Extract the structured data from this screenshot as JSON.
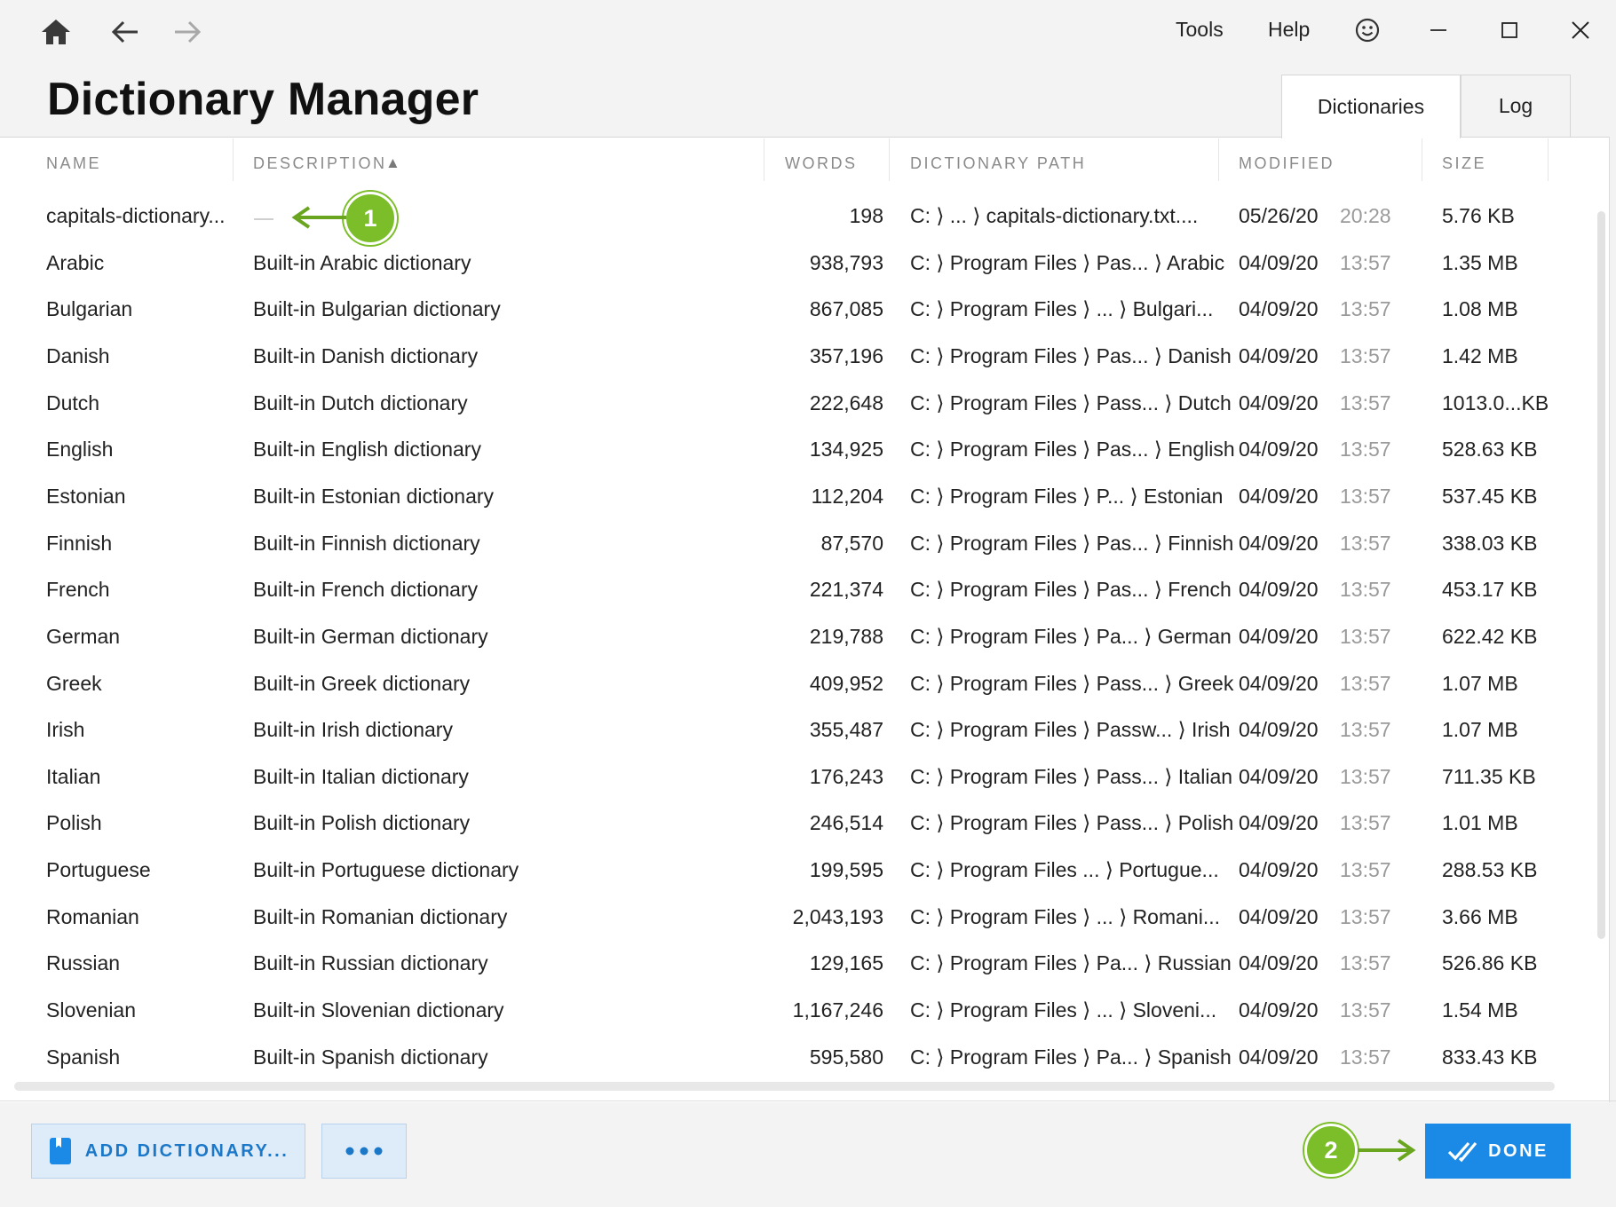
{
  "toolbar": {
    "home": "home-icon",
    "back": "back-arrow-icon",
    "forward": "forward-arrow-icon",
    "menu": [
      "Tools",
      "Help"
    ],
    "feedback": "smiley-icon",
    "minimize": "minimize-icon",
    "maximize": "maximize-icon",
    "close": "close-icon"
  },
  "page": {
    "title": "Dictionary Manager"
  },
  "tabs": [
    {
      "label": "Dictionaries",
      "active": true
    },
    {
      "label": "Log",
      "active": false
    }
  ],
  "table": {
    "columns": [
      "NAME",
      "DESCRIPTION",
      "WORDS",
      "DICTIONARY PATH",
      "MODIFIED",
      "SIZE"
    ],
    "sort": {
      "column": "DESCRIPTION",
      "direction": "ascending",
      "indicator": "▲"
    },
    "rows": [
      {
        "name": "capitals-dictionary...",
        "description": "",
        "words": "198",
        "path": "C: ⟩ ... ⟩ capitals-dictionary.txt....",
        "date": "05/26/20",
        "time": "20:28",
        "size": "5.76 KB"
      },
      {
        "name": "Arabic",
        "description": "Built-in Arabic dictionary",
        "words": "938,793",
        "path": "C: ⟩ Program Files ⟩ Pas... ⟩ Arabic",
        "date": "04/09/20",
        "time": "13:57",
        "size": "1.35 MB"
      },
      {
        "name": "Bulgarian",
        "description": "Built-in Bulgarian dictionary",
        "words": "867,085",
        "path": "C: ⟩ Program Files ⟩ ... ⟩ Bulgari...",
        "date": "04/09/20",
        "time": "13:57",
        "size": "1.08 MB"
      },
      {
        "name": "Danish",
        "description": "Built-in Danish dictionary",
        "words": "357,196",
        "path": "C: ⟩ Program Files ⟩ Pas... ⟩ Danish",
        "date": "04/09/20",
        "time": "13:57",
        "size": "1.42 MB"
      },
      {
        "name": "Dutch",
        "description": "Built-in Dutch dictionary",
        "words": "222,648",
        "path": "C: ⟩ Program Files ⟩ Pass... ⟩ Dutch",
        "date": "04/09/20",
        "time": "13:57",
        "size": "1013.0...KB"
      },
      {
        "name": "English",
        "description": "Built-in English dictionary",
        "words": "134,925",
        "path": "C: ⟩ Program Files ⟩ Pas... ⟩ English",
        "date": "04/09/20",
        "time": "13:57",
        "size": "528.63 KB"
      },
      {
        "name": "Estonian",
        "description": "Built-in Estonian dictionary",
        "words": "112,204",
        "path": "C: ⟩ Program Files ⟩ P... ⟩ Estonian",
        "date": "04/09/20",
        "time": "13:57",
        "size": "537.45 KB"
      },
      {
        "name": "Finnish",
        "description": "Built-in Finnish dictionary",
        "words": "87,570",
        "path": "C: ⟩ Program Files ⟩ Pas... ⟩ Finnish",
        "date": "04/09/20",
        "time": "13:57",
        "size": "338.03 KB"
      },
      {
        "name": "French",
        "description": "Built-in French dictionary",
        "words": "221,374",
        "path": "C: ⟩ Program Files ⟩ Pas... ⟩ French",
        "date": "04/09/20",
        "time": "13:57",
        "size": "453.17 KB"
      },
      {
        "name": "German",
        "description": "Built-in German dictionary",
        "words": "219,788",
        "path": "C: ⟩ Program Files ⟩ Pa... ⟩ German",
        "date": "04/09/20",
        "time": "13:57",
        "size": "622.42 KB"
      },
      {
        "name": "Greek",
        "description": "Built-in Greek dictionary",
        "words": "409,952",
        "path": "C: ⟩ Program Files ⟩ Pass... ⟩ Greek",
        "date": "04/09/20",
        "time": "13:57",
        "size": "1.07 MB"
      },
      {
        "name": "Irish",
        "description": "Built-in Irish dictionary",
        "words": "355,487",
        "path": "C: ⟩ Program Files ⟩ Passw... ⟩ Irish",
        "date": "04/09/20",
        "time": "13:57",
        "size": "1.07 MB"
      },
      {
        "name": "Italian",
        "description": "Built-in Italian dictionary",
        "words": "176,243",
        "path": "C: ⟩ Program Files ⟩ Pass... ⟩ Italian",
        "date": "04/09/20",
        "time": "13:57",
        "size": "711.35 KB"
      },
      {
        "name": "Polish",
        "description": "Built-in Polish dictionary",
        "words": "246,514",
        "path": "C: ⟩ Program Files ⟩ Pass... ⟩ Polish",
        "date": "04/09/20",
        "time": "13:57",
        "size": "1.01 MB"
      },
      {
        "name": "Portuguese",
        "description": "Built-in Portuguese dictionary",
        "words": "199,595",
        "path": "C: ⟩ Program Files ... ⟩ Portugue...",
        "date": "04/09/20",
        "time": "13:57",
        "size": "288.53 KB"
      },
      {
        "name": "Romanian",
        "description": "Built-in Romanian dictionary",
        "words": "2,043,193",
        "path": "C: ⟩ Program Files ⟩ ... ⟩ Romani...",
        "date": "04/09/20",
        "time": "13:57",
        "size": "3.66 MB"
      },
      {
        "name": "Russian",
        "description": "Built-in Russian dictionary",
        "words": "129,165",
        "path": "C: ⟩ Program Files ⟩ Pa... ⟩ Russian",
        "date": "04/09/20",
        "time": "13:57",
        "size": "526.86 KB"
      },
      {
        "name": "Slovenian",
        "description": "Built-in Slovenian dictionary",
        "words": "1,167,246",
        "path": "C: ⟩ Program Files ⟩ ... ⟩ Sloveni...",
        "date": "04/09/20",
        "time": "13:57",
        "size": "1.54 MB"
      },
      {
        "name": "Spanish",
        "description": "Built-in Spanish dictionary",
        "words": "595,580",
        "path": "C: ⟩ Program Files ⟩ Pa... ⟩ Spanish",
        "date": "04/09/20",
        "time": "13:57",
        "size": "833.43 KB"
      }
    ]
  },
  "footer": {
    "add_label": "ADD DICTIONARY...",
    "add_icon": "dictionary-book-icon",
    "more_icon": "more-dots-icon",
    "done_label": "DONE",
    "done_icon": "double-check-icon"
  },
  "annotations": [
    {
      "number": "1"
    },
    {
      "number": "2"
    }
  ],
  "colors": {
    "accent": "#1a8ae6",
    "button_light": "#deebf8",
    "badge_green": "#7cbd2a"
  }
}
